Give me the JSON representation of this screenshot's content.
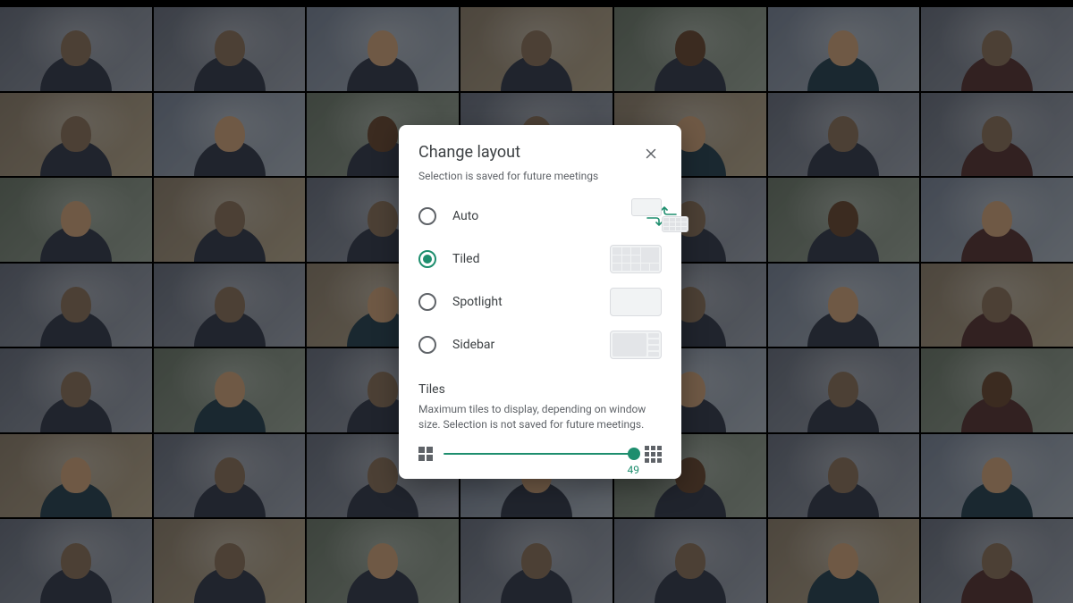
{
  "dialog": {
    "title": "Change layout",
    "subtitle": "Selection is saved for future meetings",
    "options": [
      {
        "id": "auto",
        "label": "Auto",
        "selected": false
      },
      {
        "id": "tiled",
        "label": "Tiled",
        "selected": true
      },
      {
        "id": "spotlight",
        "label": "Spotlight",
        "selected": false
      },
      {
        "id": "sidebar",
        "label": "Sidebar",
        "selected": false
      }
    ],
    "tiles_section": {
      "heading": "Tiles",
      "description": "Maximum tiles to display, depending on window size. Selection is not saved for future meetings.",
      "slider_value": "49"
    }
  },
  "colors": {
    "accent": "#1e8e6e"
  }
}
